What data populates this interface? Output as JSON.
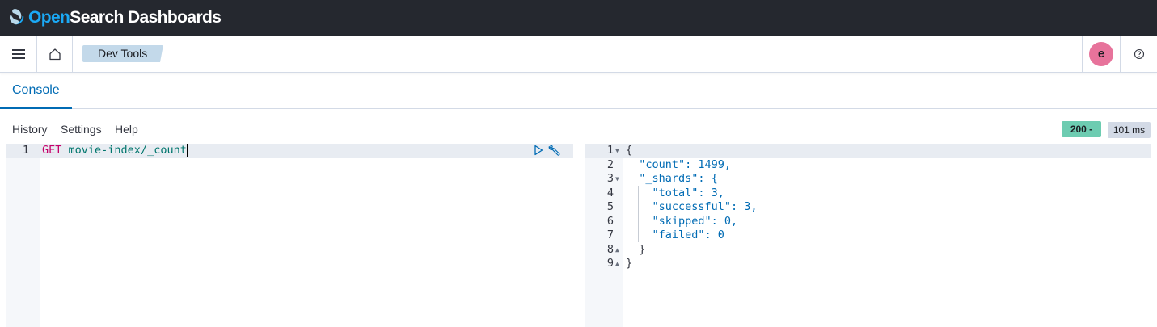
{
  "app": {
    "brand_open": "Open",
    "brand_rest": "Search Dashboards"
  },
  "nav": {
    "breadcrumb": "Dev Tools",
    "avatar_initial": "e"
  },
  "tabs": {
    "console": "Console"
  },
  "toolbar": {
    "history": "History",
    "settings": "Settings",
    "help": "Help",
    "status": "200 -",
    "time": "101 ms"
  },
  "request": {
    "line_number": "1",
    "method": "GET",
    "path": "movie-index/_count"
  },
  "response": {
    "line_numbers": [
      "1",
      "2",
      "3",
      "4",
      "5",
      "6",
      "7",
      "8",
      "9"
    ],
    "lines": [
      "{",
      "  \"count\": 1499,",
      "  \"_shards\": {",
      "    \"total\": 3,",
      "    \"successful\": 3,",
      "    \"skipped\": 0,",
      "    \"failed\": 0",
      "  }",
      "}"
    ]
  },
  "colors": {
    "accent": "#006bb4",
    "status_ok": "#6dccb1",
    "topbar": "#25282f"
  }
}
